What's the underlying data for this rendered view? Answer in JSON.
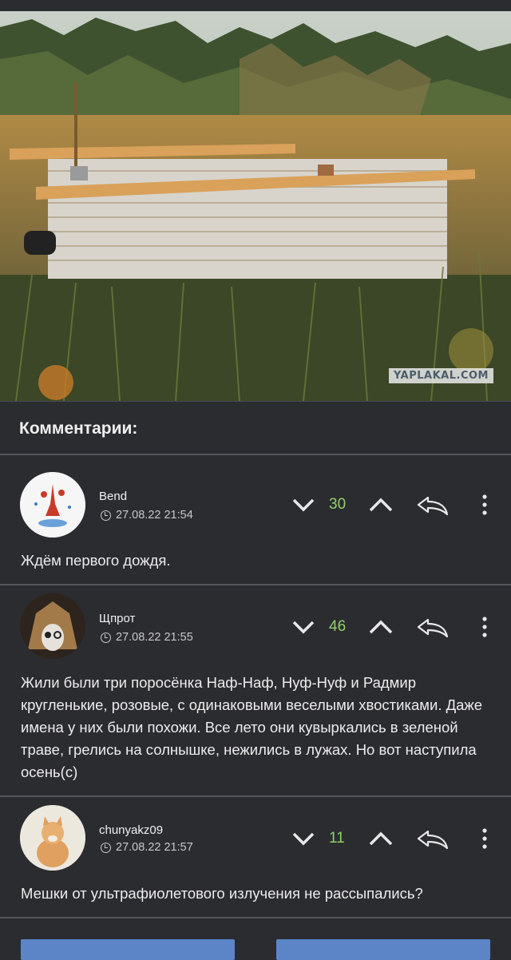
{
  "watermark": "YAPLAKAL.COM",
  "comments_header": "Комментарии:",
  "comments": [
    {
      "author": "Bend",
      "date": "27.08.22 21:54",
      "score": "30",
      "text": "Ждём первого дождя."
    },
    {
      "author": "Щпрот",
      "date": "27.08.22 21:55",
      "score": "46",
      "text": "Жили были три поросёнка Наф-Наф, Нуф-Нуф и Радмир кругленькие, розовые, с одинаковыми веселыми хвостиками. Даже имена у них были похожи. Все лето они кувыркались в зеленой траве, грелись на солнышке, нежились в лужах. Но вот наступила осень(с)"
    },
    {
      "author": "chunyakz09",
      "date": "27.08.22 21:57",
      "score": "11",
      "text": "Мешки от ультрафиолетового излучения не рассыпались?"
    }
  ],
  "icons": {
    "vote_down": "chevron-down-icon",
    "vote_up": "chevron-up-icon",
    "reply": "reply-arrow-icon",
    "more": "more-vertical-icon",
    "time": "clock-icon"
  },
  "colors": {
    "background": "#2b2c30",
    "score": "#8fd16a",
    "button": "#5b85c7"
  }
}
